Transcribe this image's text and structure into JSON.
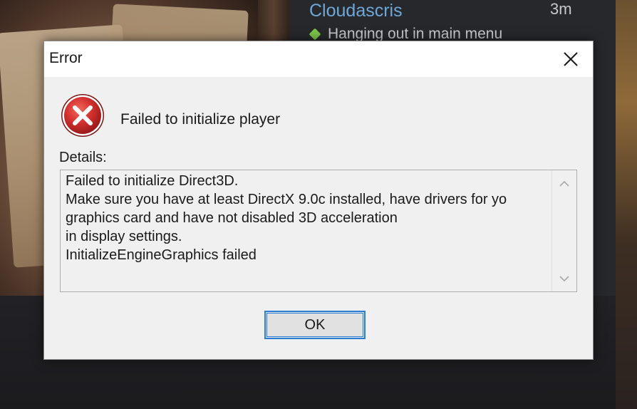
{
  "background": {
    "friend": {
      "name": "Cloudascris",
      "time": "3m",
      "status": "Hanging out in main menu"
    }
  },
  "dialog": {
    "title": "Error",
    "message": "Failed to initialize player",
    "details_label": "Details:",
    "details_lines": [
      "Failed to initialize Direct3D.",
      "Make sure you have at least DirectX 9.0c installed, have drivers for yo",
      "graphics card and have not disabled 3D acceleration",
      "in display settings.",
      "InitializeEngineGraphics failed"
    ],
    "ok_label": "OK",
    "icons": {
      "error": "error-icon",
      "close": "close-icon",
      "scroll_up": "chevron-up-icon",
      "scroll_down": "chevron-down-icon"
    }
  },
  "colors": {
    "error_red": "#d32f2f",
    "focus_blue": "#2a7fd4",
    "friend_name": "#6ea7d8",
    "online_green": "#7cc34a"
  }
}
